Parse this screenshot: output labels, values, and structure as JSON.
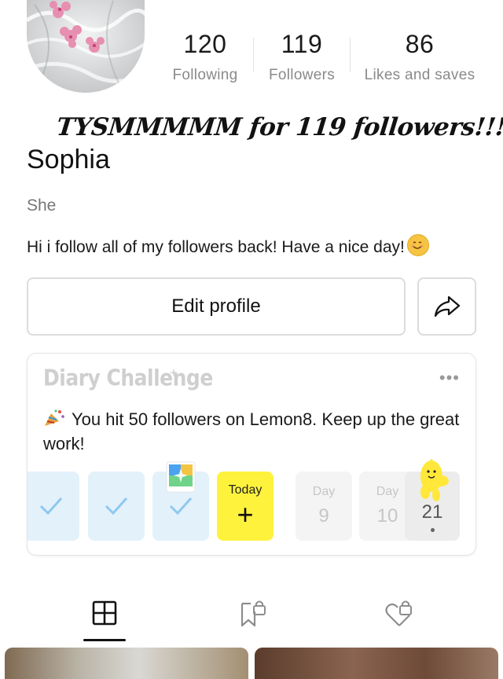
{
  "profile": {
    "name": "Sophia",
    "pronoun": "She",
    "bio": "Hi i follow all of my followers back! Have a nice day!",
    "overlay_caption": "TYSMMMMM for 119 followers!!!!"
  },
  "stats": [
    {
      "value": "120",
      "label": "Following"
    },
    {
      "value": "119",
      "label": "Followers"
    },
    {
      "value": "86",
      "label": "Likes and saves"
    }
  ],
  "buttons": {
    "edit_profile": "Edit profile"
  },
  "diary": {
    "title": "Diary Challenge",
    "more": "•••",
    "message": "You hit 50 followers on Lemon8. Keep up the great work!",
    "today_label": "Today",
    "today_icon": "+",
    "days": [
      {
        "label": "Day",
        "num": "9"
      },
      {
        "label": "Day",
        "num": "10"
      },
      {
        "label": "",
        "num": "21"
      }
    ]
  },
  "tabs": [
    {
      "icon": "grid-icon",
      "active": true
    },
    {
      "icon": "bookmark-lock-icon",
      "active": false
    },
    {
      "icon": "heart-lock-icon",
      "active": false
    }
  ],
  "colors": {
    "today": "#fff23d",
    "done": "#e3f1fb",
    "check": "#8ec8ef"
  }
}
